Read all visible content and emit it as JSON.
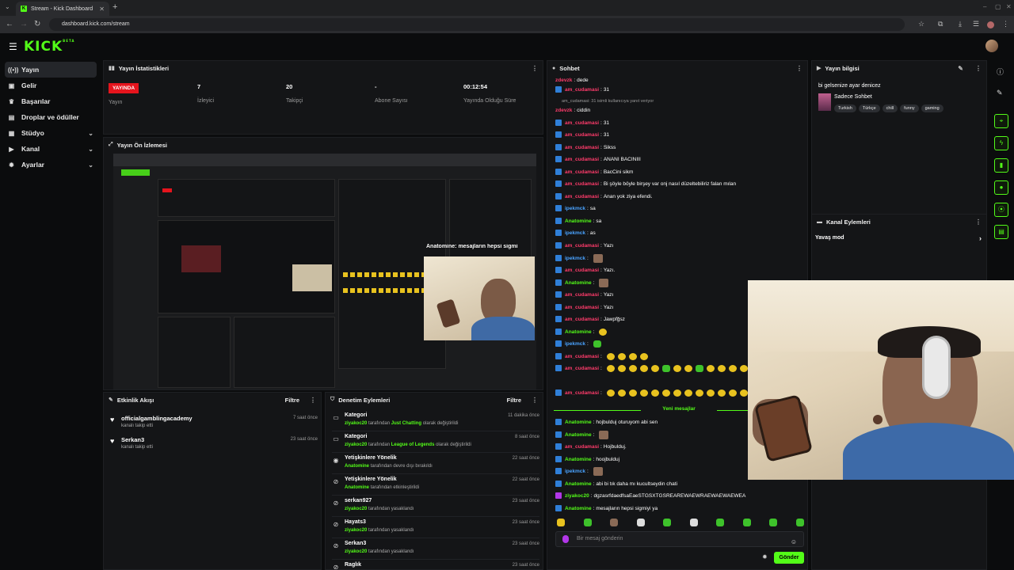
{
  "browser": {
    "tab_title": "Stream - Kick Dashboard",
    "url": "dashboard.kick.com/stream"
  },
  "app": {
    "logo": "KICK",
    "logo_sup": "BETA"
  },
  "sidebar": {
    "items": [
      {
        "label": "Yayın",
        "icon": "broadcast-icon"
      },
      {
        "label": "Gelir",
        "icon": "wallet-icon"
      },
      {
        "label": "Başarılar",
        "icon": "trophy-icon"
      },
      {
        "label": "Droplar ve ödüller",
        "icon": "gift-icon"
      },
      {
        "label": "Stüdyo",
        "icon": "studio-icon"
      },
      {
        "label": "Kanal",
        "icon": "channel-icon"
      },
      {
        "label": "Ayarlar",
        "icon": "gear-icon"
      }
    ]
  },
  "stats": {
    "title": "Yayın İstatistikleri",
    "live_badge": "YAYINDA",
    "live_label": "Yayın",
    "viewers_value": "7",
    "viewers_label": "İzleyici",
    "followers_value": "20",
    "followers_label": "Takipçi",
    "subs_value": "-",
    "subs_label": "Abone Sayısı",
    "uptime_value": "00:12:54",
    "uptime_label": "Yayında Olduğu Süre"
  },
  "preview": {
    "title": "Yayın Ön İzlemesi",
    "overlay_text": "Anatomine: mesajların hepsi sigmi"
  },
  "events": {
    "title": "Etkinlik Akışı",
    "filter": "Filtre",
    "items": [
      {
        "name": "officialgamblingacademy",
        "sub": "kanalı takip etti",
        "time": "7 saat önce"
      },
      {
        "name": "Serkan3",
        "sub": "kanalı takip etti",
        "time": "23 saat önce"
      }
    ]
  },
  "moderation": {
    "title": "Denetim Eylemleri",
    "filter": "Filtre",
    "by": "tarafından",
    "items": [
      {
        "title": "Kategori",
        "user": "ziyakoc20",
        "highlight": "Just Chatting",
        "rest": "olarak değiştirildi",
        "time": "11 dakika önce",
        "icon": "category-icon"
      },
      {
        "title": "Kategori",
        "user": "ziyakoc20",
        "highlight": "League of Legends",
        "rest": "olarak değiştirildi",
        "time": "8 saat önce",
        "icon": "category-icon"
      },
      {
        "title": "Yetişkinlere Yönelik",
        "user": "Anatomine",
        "highlight": "",
        "rest": "devre dışı bırakıldı",
        "time": "22 saat önce",
        "icon": "eye-icon"
      },
      {
        "title": "Yetişkinlere Yönelik",
        "user": "Anatomine",
        "highlight": "",
        "rest": "etkinleştirildi",
        "time": "22 saat önce",
        "icon": "eye-off-icon"
      },
      {
        "title": "serkan927",
        "user": "ziyakoc20",
        "highlight": "",
        "rest": "yasaklandı",
        "time": "23 saat önce",
        "icon": "ban-icon"
      },
      {
        "title": "Hayats3",
        "user": "ziyakoc20",
        "highlight": "",
        "rest": "yasaklandı",
        "time": "23 saat önce",
        "icon": "ban-icon"
      },
      {
        "title": "Serkan3",
        "user": "ziyakoc20",
        "highlight": "",
        "rest": "yasaklandı",
        "time": "23 saat önce",
        "icon": "ban-icon"
      },
      {
        "title": "Raglık",
        "user": "",
        "highlight": "",
        "rest": "",
        "time": "23 saat önce",
        "icon": "ban-icon"
      }
    ]
  },
  "chat": {
    "title": "Sohbet",
    "new_messages": "Yeni mesajlar",
    "input_placeholder": "Bir mesaj gönderin",
    "send_label": "Gönder",
    "reply_note": "am_cudamasi: 31 isimli kullanıcıya yanıt veriyor",
    "messages": [
      {
        "user": "zdevzk",
        "color": "#ff3b6b",
        "text": "dede",
        "badge": false,
        "emotes": ""
      },
      {
        "user": "am_cudamasi",
        "color": "#ff3b6b",
        "text": "31",
        "badge": true,
        "emotes": ""
      },
      {
        "user": "zdevzk",
        "color": "#ff3b6b",
        "text": "ciddin",
        "badge": false,
        "emotes": ""
      },
      {
        "user": "am_cudamasi",
        "color": "#ff3b6b",
        "text": "31",
        "badge": true,
        "emotes": ""
      },
      {
        "user": "am_cudamasi",
        "color": "#ff3b6b",
        "text": "31",
        "badge": true,
        "emotes": ""
      },
      {
        "user": "am_cudamasi",
        "color": "#ff3b6b",
        "text": "Sikss",
        "badge": true,
        "emotes": ""
      },
      {
        "user": "am_cudamasi",
        "color": "#ff3b6b",
        "text": "ANANI BACINIII",
        "badge": true,
        "emotes": ""
      },
      {
        "user": "am_cudamasi",
        "color": "#ff3b6b",
        "text": "BacCini sikm",
        "badge": true,
        "emotes": ""
      },
      {
        "user": "am_cudamasi",
        "color": "#ff3b6b",
        "text": "Bi şöyle böyle birşey var onj nasıl düzeltebiliriz falan mılan",
        "badge": true,
        "emotes": ""
      },
      {
        "user": "am_cudamasi",
        "color": "#ff3b6b",
        "text": "Anan yok ziya efendi.",
        "badge": true,
        "emotes": ""
      },
      {
        "user": "ipekmck",
        "color": "#4aa3ff",
        "text": "sa",
        "badge": true,
        "emotes": ""
      },
      {
        "user": "Anatomine",
        "color": "#53fc18",
        "text": "sa",
        "badge": true,
        "emotes": ""
      },
      {
        "user": "ipekmck",
        "color": "#4aa3ff",
        "text": "as",
        "badge": true,
        "emotes": ""
      },
      {
        "user": "am_cudamasi",
        "color": "#ff3b6b",
        "text": "Yazı",
        "badge": true,
        "emotes": ""
      },
      {
        "user": "ipekmck",
        "color": "#4aa3ff",
        "text": "",
        "badge": true,
        "emotes": "p"
      },
      {
        "user": "am_cudamasi",
        "color": "#ff3b6b",
        "text": "Yazı.",
        "badge": true,
        "emotes": ""
      },
      {
        "user": "Anatomine",
        "color": "#53fc18",
        "text": "",
        "badge": true,
        "emotes": "p"
      },
      {
        "user": "am_cudamasi",
        "color": "#ff3b6b",
        "text": "Yazı",
        "badge": true,
        "emotes": ""
      },
      {
        "user": "am_cudamasi",
        "color": "#ff3b6b",
        "text": "Yazı",
        "badge": true,
        "emotes": ""
      },
      {
        "user": "am_cudamasi",
        "color": "#ff3b6b",
        "text": "Jawpfğsz",
        "badge": true,
        "emotes": ""
      },
      {
        "user": "Anatomine",
        "color": "#53fc18",
        "text": "",
        "badge": true,
        "emotes": "y"
      },
      {
        "user": "ipekmck",
        "color": "#4aa3ff",
        "text": "",
        "badge": true,
        "emotes": "g"
      },
      {
        "user": "am_cudamasi",
        "color": "#ff3b6b",
        "text": "",
        "badge": true,
        "emotes": "yyyy"
      },
      {
        "user": "am_cudamasi",
        "color": "#ff3b6b",
        "text": "",
        "badge": true,
        "emotes": "yyyyygyygyyyy"
      },
      {
        "user": "am_cudamasi",
        "color": "#ff3b6b",
        "text": "",
        "badge": true,
        "emotes": "yyyyyyyyyyyyy"
      }
    ],
    "new_list": [
      {
        "user": "Anatomine",
        "color": "#53fc18",
        "text": "hojbulduj oturuyom abi sen",
        "badge": "b",
        "emotes": ""
      },
      {
        "user": "Anatomine",
        "color": "#53fc18",
        "text": "",
        "badge": "b",
        "emotes": "p"
      },
      {
        "user": "am_cudamasi",
        "color": "#ff3b6b",
        "text": "Hojbulduj.",
        "badge": "b",
        "emotes": ""
      },
      {
        "user": "Anatomine",
        "color": "#53fc18",
        "text": "hoojbulduj",
        "badge": "b",
        "emotes": ""
      },
      {
        "user": "ipekmck",
        "color": "#4aa3ff",
        "text": "",
        "badge": "b",
        "emotes": "p"
      },
      {
        "user": "Anatomine",
        "color": "#53fc18",
        "text": "abi bi tık daha mı kucultseydin chati",
        "badge": "b",
        "emotes": ""
      },
      {
        "user": "ziyakoc20",
        "color": "#53fc18",
        "text": "dgzasrfdaedfsaEaeSTGSXTGSREAREWAEWRAEWAEWAEWEA",
        "badge": "p",
        "emotes": ""
      },
      {
        "user": "Anatomine",
        "color": "#53fc18",
        "text": "mesajların hepsi sigmiyi ya",
        "badge": "b",
        "emotes": ""
      }
    ]
  },
  "stream_info": {
    "title": "Yayın bilgisi",
    "stream_title": "bi gelsenize ayar denicez",
    "category": "Sadece Sohbet",
    "tags": [
      "Turkish",
      "Türkçe",
      "chill",
      "funny",
      "gaming"
    ]
  },
  "channel_actions": {
    "title": "Kanal Eylemleri",
    "slow_mode": "Yavaş mod"
  }
}
